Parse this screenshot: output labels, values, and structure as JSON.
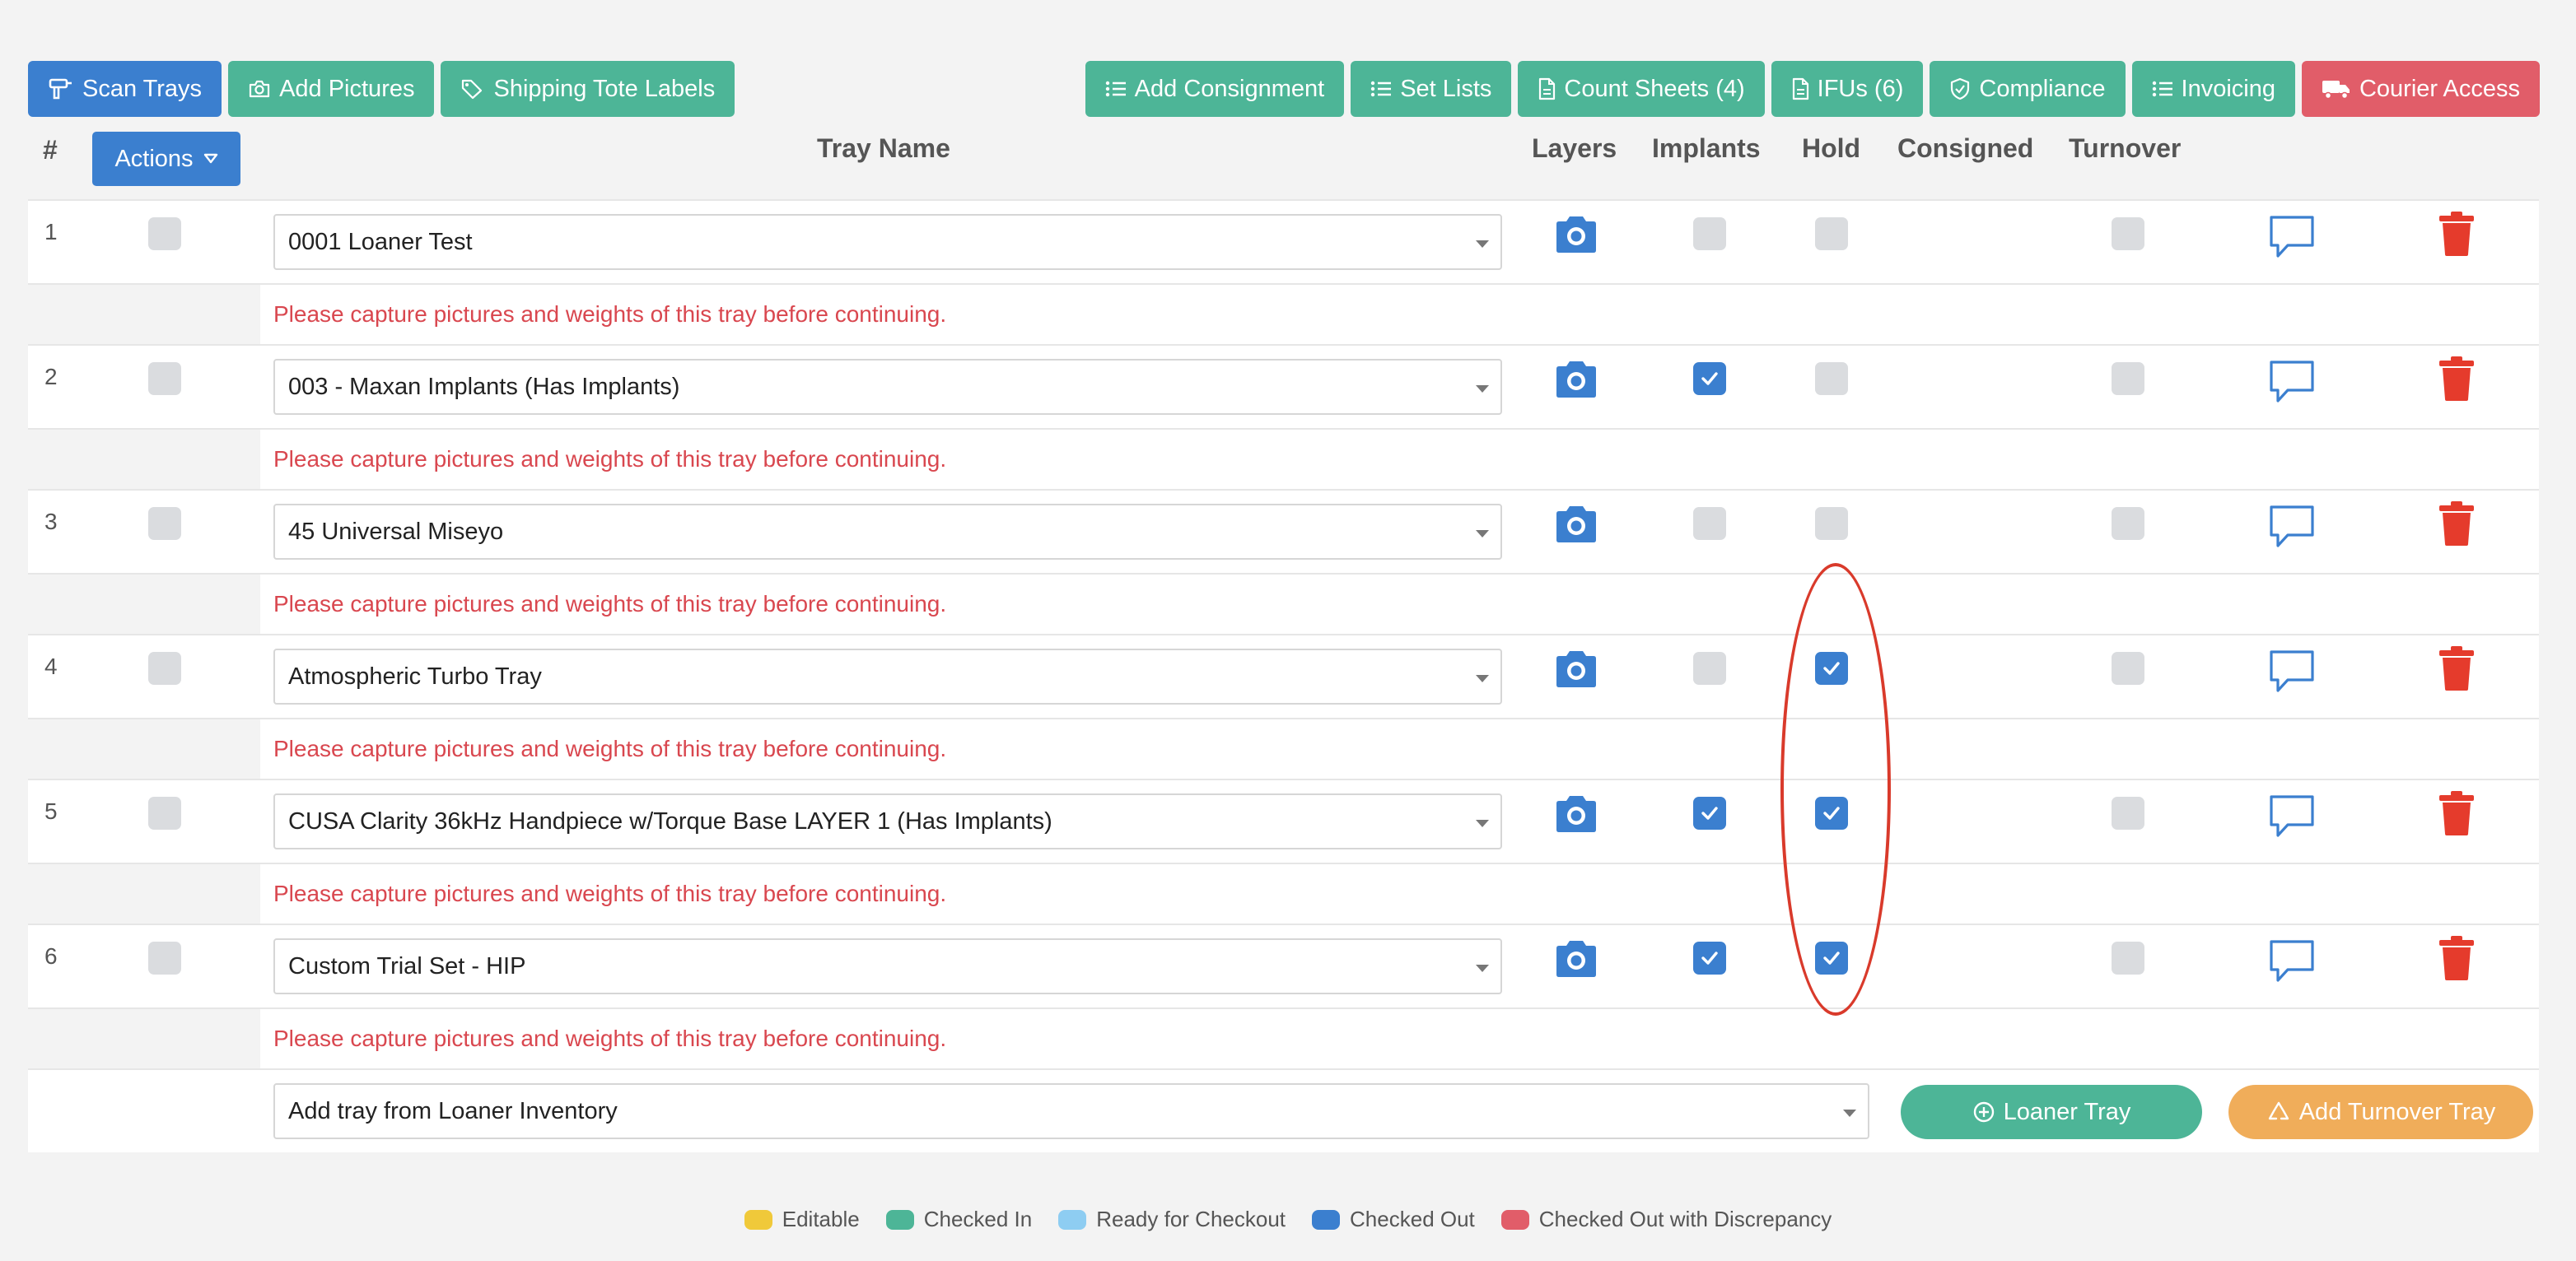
{
  "toolbar": {
    "left": [
      {
        "label": "Scan Trays",
        "icon": "scanner-icon",
        "color": "#3b7fcf"
      },
      {
        "label": "Add Pictures",
        "icon": "camera-icon",
        "color": "#4db597"
      },
      {
        "label": "Shipping Tote Labels",
        "icon": "tags-icon",
        "color": "#4db597"
      }
    ],
    "right": [
      {
        "label": "Add Consignment",
        "icon": "list-icon",
        "color": "#4db597"
      },
      {
        "label": "Set Lists",
        "icon": "list-icon",
        "color": "#4db597"
      },
      {
        "label": "Count Sheets (4)",
        "icon": "document-icon",
        "color": "#4db597"
      },
      {
        "label": "IFUs (6)",
        "icon": "document-icon",
        "color": "#4db597"
      },
      {
        "label": "Compliance",
        "icon": "shield-icon",
        "color": "#4db597"
      },
      {
        "label": "Invoicing",
        "icon": "list-icon",
        "color": "#4db597"
      },
      {
        "label": "Courier Access",
        "icon": "truck-icon",
        "color": "#e15d69"
      }
    ]
  },
  "header": {
    "num": "#",
    "actions": "Actions",
    "tray_name": "Tray Name",
    "layers": "Layers",
    "implants": "Implants",
    "hold": "Hold",
    "consigned": "Consigned",
    "turnover": "Turnover"
  },
  "message": "Please capture pictures and weights of this tray before continuing.",
  "rows": [
    {
      "num": "1",
      "name": "0001 Loaner Test",
      "implants": false,
      "hold": false,
      "turnover": false
    },
    {
      "num": "2",
      "name": "003 - Maxan Implants (Has Implants)",
      "implants": true,
      "hold": false,
      "turnover": false
    },
    {
      "num": "3",
      "name": "45 Universal Miseyo",
      "implants": false,
      "hold": false,
      "turnover": false
    },
    {
      "num": "4",
      "name": "Atmospheric Turbo Tray",
      "implants": false,
      "hold": true,
      "turnover": false
    },
    {
      "num": "5",
      "name": "CUSA Clarity 36kHz Handpiece w/Torque Base LAYER 1 (Has Implants)",
      "implants": true,
      "hold": true,
      "turnover": false
    },
    {
      "num": "6",
      "name": "Custom Trial Set - HIP",
      "implants": true,
      "hold": true,
      "turnover": false
    }
  ],
  "add_row": {
    "placeholder": "Add tray from Loaner Inventory",
    "loaner_btn": "Loaner Tray",
    "turnover_btn": "Add Turnover Tray"
  },
  "legend": [
    {
      "label": "Editable",
      "color": "#f0c93a"
    },
    {
      "label": "Checked In",
      "color": "#4db597"
    },
    {
      "label": "Ready for Checkout",
      "color": "#8ecdf2"
    },
    {
      "label": "Checked Out",
      "color": "#3b7fcf"
    },
    {
      "label": "Checked Out with Discrepancy",
      "color": "#e15d69"
    }
  ],
  "colors": {
    "primary": "#3b7fcf",
    "success": "#4db597",
    "danger": "#e15d69",
    "warning": "#f0ad5a",
    "error_text": "#d9474f",
    "trash": "#e53b2c"
  }
}
